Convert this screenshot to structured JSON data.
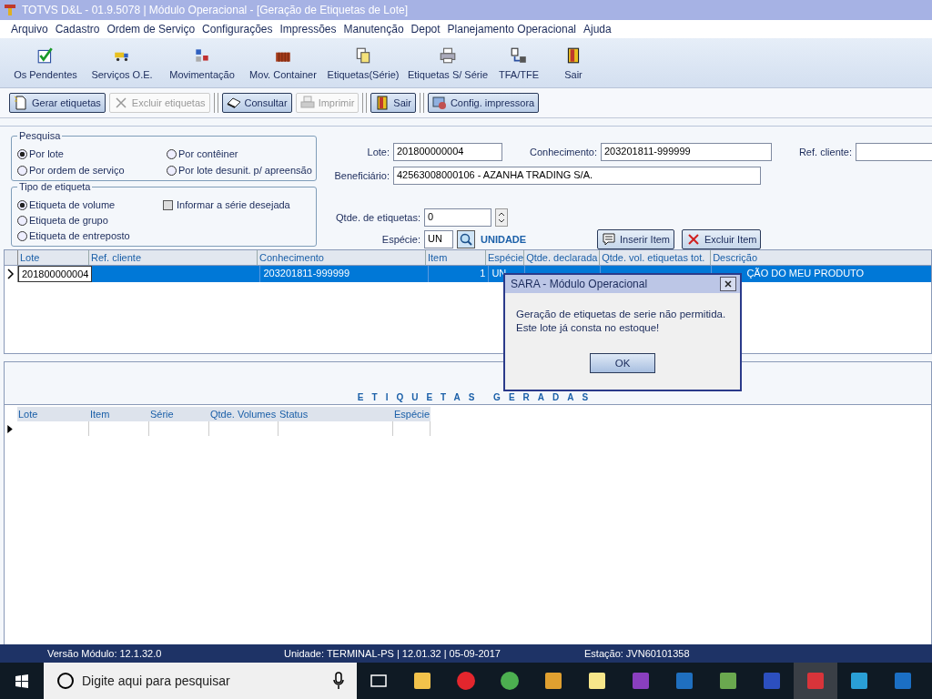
{
  "window": {
    "title": "TOTVS D&L - 01.9.5078 | Módulo Operacional - [Geração de Etiquetas de Lote]"
  },
  "menu": [
    "Arquivo",
    "Cadastro",
    "Ordem de Serviço",
    "Configurações",
    "Impressões",
    "Manutenção",
    "Depot",
    "Planejamento Operacional",
    "Ajuda"
  ],
  "toolbar": [
    "Os Pendentes",
    "Serviços O.E.",
    "Movimentação",
    "Mov. Container",
    "Etiquetas(Série)",
    "Etiquetas S/ Série",
    "TFA/TFE",
    "Sair"
  ],
  "actions": [
    {
      "label": "Gerar etiquetas",
      "disabled": false
    },
    {
      "label": "Excluir etiquetas",
      "disabled": true
    },
    {
      "label": "Consultar",
      "disabled": false
    },
    {
      "label": "Imprimir",
      "disabled": true
    },
    {
      "label": "Sair",
      "disabled": false
    },
    {
      "label": "Config. impressora",
      "disabled": false
    }
  ],
  "pesquisa": {
    "title": "Pesquisa",
    "options": [
      {
        "label": "Por lote",
        "selected": true
      },
      {
        "label": "Por contêiner",
        "selected": false
      },
      {
        "label": "Por ordem de serviço",
        "selected": false
      },
      {
        "label": "Por lote desunit. p/ apreensão",
        "selected": false
      }
    ]
  },
  "tipo": {
    "title": "Tipo de etiqueta",
    "options": [
      {
        "label": "Etiqueta de volume",
        "selected": true
      },
      {
        "label": "Etiqueta de grupo",
        "selected": false
      },
      {
        "label": "Etiqueta de entreposto",
        "selected": false
      }
    ],
    "checkbox": {
      "label": "Informar a série desejada",
      "checked": false
    }
  },
  "fields": {
    "lote": {
      "label": "Lote:",
      "value": "201800000004"
    },
    "conhecimento": {
      "label": "Conhecimento:",
      "value": "203201811-999999"
    },
    "ref_cliente": {
      "label": "Ref. cliente:"
    },
    "beneficiario": {
      "label": "Beneficiário:",
      "value": "42563008000106 - AZANHA TRADING S/A."
    },
    "qtde": {
      "label": "Qtde. de etiquetas:",
      "value": "0"
    },
    "especie": {
      "label": "Espécie:",
      "value": "UN",
      "description": "UNIDADE"
    }
  },
  "item_buttons": [
    "Inserir Item",
    "Excluir Item"
  ],
  "lotes_table": {
    "columns": [
      "Lote",
      "Ref. cliente",
      "Conhecimento",
      "Item",
      "Espécie",
      "Qtde. declarada",
      "Qtde. vol. etiquetas tot.",
      "Descrição"
    ],
    "rows": [
      {
        "selected": true,
        "cells": [
          "201800000004",
          "",
          "203201811-999999",
          "1",
          "UN",
          "",
          "",
          "ÇÃO DO MEU PRODUTO"
        ]
      }
    ]
  },
  "etiquetas": {
    "title": "ETIQUETAS GERADAS",
    "columns": [
      "Lote",
      "Item",
      "Série",
      "Qtde. Volumes",
      "Status",
      "Espécie"
    ]
  },
  "status_bar": [
    "Versão Módulo:  12.1.32.0",
    "Unidade: TERMINAL-PS | 12.01.32 | 05-09-2017",
    "Estação: JVN60101358"
  ],
  "dialog": {
    "title": "SARA - Módulo Operacional",
    "message": [
      "Geração de etiquetas de serie não permitida.",
      "Este lote já consta no estoque!"
    ],
    "button": "OK"
  },
  "taskbar": {
    "search_placeholder": "Digite aqui para pesquisar"
  }
}
